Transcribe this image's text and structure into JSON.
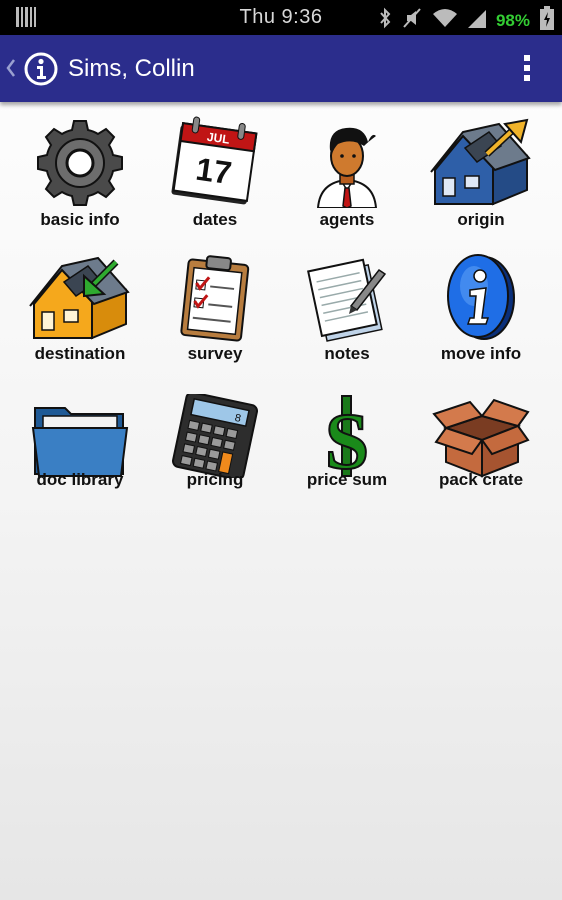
{
  "status_bar": {
    "time": "Thu 9:36",
    "battery": "98%"
  },
  "action_bar": {
    "title": "Sims, Collin"
  },
  "tiles": [
    {
      "label": "basic info",
      "icon": "gear-icon"
    },
    {
      "label": "dates",
      "icon": "calendar-icon",
      "calendar_month": "JUL",
      "calendar_day": "17"
    },
    {
      "label": "agents",
      "icon": "agent-person-icon"
    },
    {
      "label": "origin",
      "icon": "origin-house-icon"
    },
    {
      "label": "destination",
      "icon": "destination-house-icon"
    },
    {
      "label": "survey",
      "icon": "clipboard-survey-icon"
    },
    {
      "label": "notes",
      "icon": "notes-paper-icon"
    },
    {
      "label": "move info",
      "icon": "info-circle-icon"
    },
    {
      "label": "doc library",
      "icon": "folder-icon"
    },
    {
      "label": "pricing",
      "icon": "calculator-icon"
    },
    {
      "label": "price sum",
      "icon": "dollar-sign-icon"
    },
    {
      "label": "pack crate",
      "icon": "box-icon"
    }
  ],
  "colors": {
    "action_bar": "#2b2d8c",
    "battery": "#33cc33"
  }
}
